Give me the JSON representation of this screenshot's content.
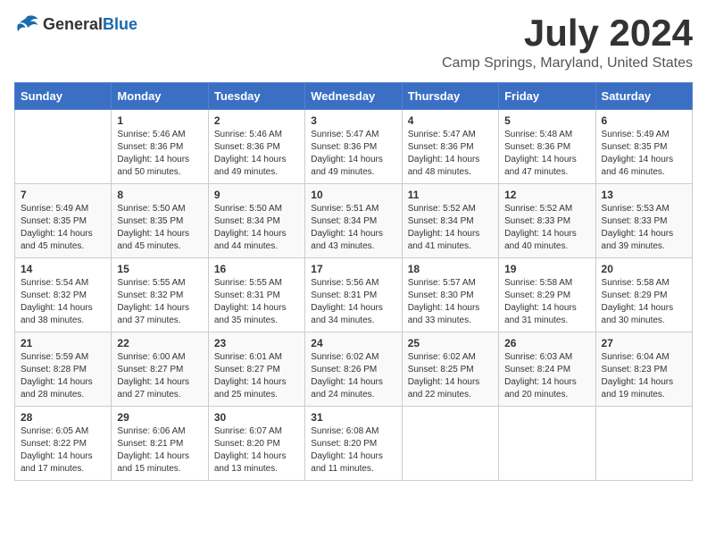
{
  "logo": {
    "general": "General",
    "blue": "Blue"
  },
  "title": "July 2024",
  "subtitle": "Camp Springs, Maryland, United States",
  "days_header": [
    "Sunday",
    "Monday",
    "Tuesday",
    "Wednesday",
    "Thursday",
    "Friday",
    "Saturday"
  ],
  "weeks": [
    [
      {
        "day": "",
        "info": ""
      },
      {
        "day": "1",
        "info": "Sunrise: 5:46 AM\nSunset: 8:36 PM\nDaylight: 14 hours\nand 50 minutes."
      },
      {
        "day": "2",
        "info": "Sunrise: 5:46 AM\nSunset: 8:36 PM\nDaylight: 14 hours\nand 49 minutes."
      },
      {
        "day": "3",
        "info": "Sunrise: 5:47 AM\nSunset: 8:36 PM\nDaylight: 14 hours\nand 49 minutes."
      },
      {
        "day": "4",
        "info": "Sunrise: 5:47 AM\nSunset: 8:36 PM\nDaylight: 14 hours\nand 48 minutes."
      },
      {
        "day": "5",
        "info": "Sunrise: 5:48 AM\nSunset: 8:36 PM\nDaylight: 14 hours\nand 47 minutes."
      },
      {
        "day": "6",
        "info": "Sunrise: 5:49 AM\nSunset: 8:35 PM\nDaylight: 14 hours\nand 46 minutes."
      }
    ],
    [
      {
        "day": "7",
        "info": "Sunrise: 5:49 AM\nSunset: 8:35 PM\nDaylight: 14 hours\nand 45 minutes."
      },
      {
        "day": "8",
        "info": "Sunrise: 5:50 AM\nSunset: 8:35 PM\nDaylight: 14 hours\nand 45 minutes."
      },
      {
        "day": "9",
        "info": "Sunrise: 5:50 AM\nSunset: 8:34 PM\nDaylight: 14 hours\nand 44 minutes."
      },
      {
        "day": "10",
        "info": "Sunrise: 5:51 AM\nSunset: 8:34 PM\nDaylight: 14 hours\nand 43 minutes."
      },
      {
        "day": "11",
        "info": "Sunrise: 5:52 AM\nSunset: 8:34 PM\nDaylight: 14 hours\nand 41 minutes."
      },
      {
        "day": "12",
        "info": "Sunrise: 5:52 AM\nSunset: 8:33 PM\nDaylight: 14 hours\nand 40 minutes."
      },
      {
        "day": "13",
        "info": "Sunrise: 5:53 AM\nSunset: 8:33 PM\nDaylight: 14 hours\nand 39 minutes."
      }
    ],
    [
      {
        "day": "14",
        "info": "Sunrise: 5:54 AM\nSunset: 8:32 PM\nDaylight: 14 hours\nand 38 minutes."
      },
      {
        "day": "15",
        "info": "Sunrise: 5:55 AM\nSunset: 8:32 PM\nDaylight: 14 hours\nand 37 minutes."
      },
      {
        "day": "16",
        "info": "Sunrise: 5:55 AM\nSunset: 8:31 PM\nDaylight: 14 hours\nand 35 minutes."
      },
      {
        "day": "17",
        "info": "Sunrise: 5:56 AM\nSunset: 8:31 PM\nDaylight: 14 hours\nand 34 minutes."
      },
      {
        "day": "18",
        "info": "Sunrise: 5:57 AM\nSunset: 8:30 PM\nDaylight: 14 hours\nand 33 minutes."
      },
      {
        "day": "19",
        "info": "Sunrise: 5:58 AM\nSunset: 8:29 PM\nDaylight: 14 hours\nand 31 minutes."
      },
      {
        "day": "20",
        "info": "Sunrise: 5:58 AM\nSunset: 8:29 PM\nDaylight: 14 hours\nand 30 minutes."
      }
    ],
    [
      {
        "day": "21",
        "info": "Sunrise: 5:59 AM\nSunset: 8:28 PM\nDaylight: 14 hours\nand 28 minutes."
      },
      {
        "day": "22",
        "info": "Sunrise: 6:00 AM\nSunset: 8:27 PM\nDaylight: 14 hours\nand 27 minutes."
      },
      {
        "day": "23",
        "info": "Sunrise: 6:01 AM\nSunset: 8:27 PM\nDaylight: 14 hours\nand 25 minutes."
      },
      {
        "day": "24",
        "info": "Sunrise: 6:02 AM\nSunset: 8:26 PM\nDaylight: 14 hours\nand 24 minutes."
      },
      {
        "day": "25",
        "info": "Sunrise: 6:02 AM\nSunset: 8:25 PM\nDaylight: 14 hours\nand 22 minutes."
      },
      {
        "day": "26",
        "info": "Sunrise: 6:03 AM\nSunset: 8:24 PM\nDaylight: 14 hours\nand 20 minutes."
      },
      {
        "day": "27",
        "info": "Sunrise: 6:04 AM\nSunset: 8:23 PM\nDaylight: 14 hours\nand 19 minutes."
      }
    ],
    [
      {
        "day": "28",
        "info": "Sunrise: 6:05 AM\nSunset: 8:22 PM\nDaylight: 14 hours\nand 17 minutes."
      },
      {
        "day": "29",
        "info": "Sunrise: 6:06 AM\nSunset: 8:21 PM\nDaylight: 14 hours\nand 15 minutes."
      },
      {
        "day": "30",
        "info": "Sunrise: 6:07 AM\nSunset: 8:20 PM\nDaylight: 14 hours\nand 13 minutes."
      },
      {
        "day": "31",
        "info": "Sunrise: 6:08 AM\nSunset: 8:20 PM\nDaylight: 14 hours\nand 11 minutes."
      },
      {
        "day": "",
        "info": ""
      },
      {
        "day": "",
        "info": ""
      },
      {
        "day": "",
        "info": ""
      }
    ]
  ]
}
